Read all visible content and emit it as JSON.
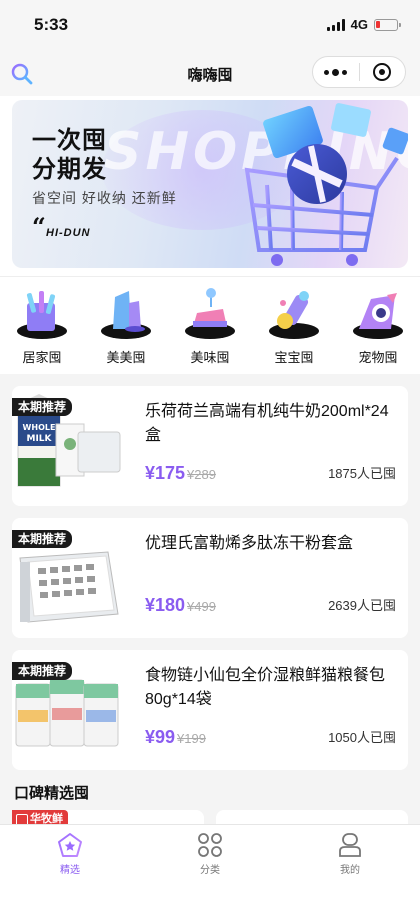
{
  "status_bar": {
    "time": "5:33",
    "network": "4G"
  },
  "nav": {
    "title": "嗨嗨囤"
  },
  "banner": {
    "headline_line1": "一次囤",
    "headline_line2": "分期发",
    "bg_text": "SHOPPING",
    "subtitle": "省空间 好收纳 还新鲜",
    "quote_mark": "“",
    "brand": "HI-DUN"
  },
  "categories": [
    {
      "label": "居家囤",
      "icon": "home-goods-icon"
    },
    {
      "label": "美美囤",
      "icon": "cosmetics-icon"
    },
    {
      "label": "美味囤",
      "icon": "cake-icon"
    },
    {
      "label": "宝宝囤",
      "icon": "baby-bottle-icon"
    },
    {
      "label": "宠物囤",
      "icon": "pet-icon"
    }
  ],
  "products": [
    {
      "badge": "本期推荐",
      "title": "乐荷荷兰高端有机纯牛奶200ml*24盒",
      "price": "¥175",
      "original_price": "¥289",
      "count": "1875人已囤"
    },
    {
      "badge": "本期推荐",
      "title": "优理氏富勒烯多肽冻干粉套盒",
      "price": "¥180",
      "original_price": "¥499",
      "count": "2639人已囤"
    },
    {
      "badge": "本期推荐",
      "title": "食物链小仙包全价湿粮鲜猫粮餐包80g*14袋",
      "price": "¥99",
      "original_price": "¥199",
      "count": "1050人已囤"
    }
  ],
  "section": {
    "title": "口碑精选囤",
    "peek_badge": "华牧鲜"
  },
  "tabs": [
    {
      "label": "精选",
      "icon": "star-icon",
      "active": true
    },
    {
      "label": "分类",
      "icon": "grid-icon",
      "active": false
    },
    {
      "label": "我的",
      "icon": "user-icon",
      "active": false
    }
  ],
  "colors": {
    "accent": "#8a5cf0",
    "badge": "#1a1a1a",
    "sale_badge": "#e23b3b"
  }
}
